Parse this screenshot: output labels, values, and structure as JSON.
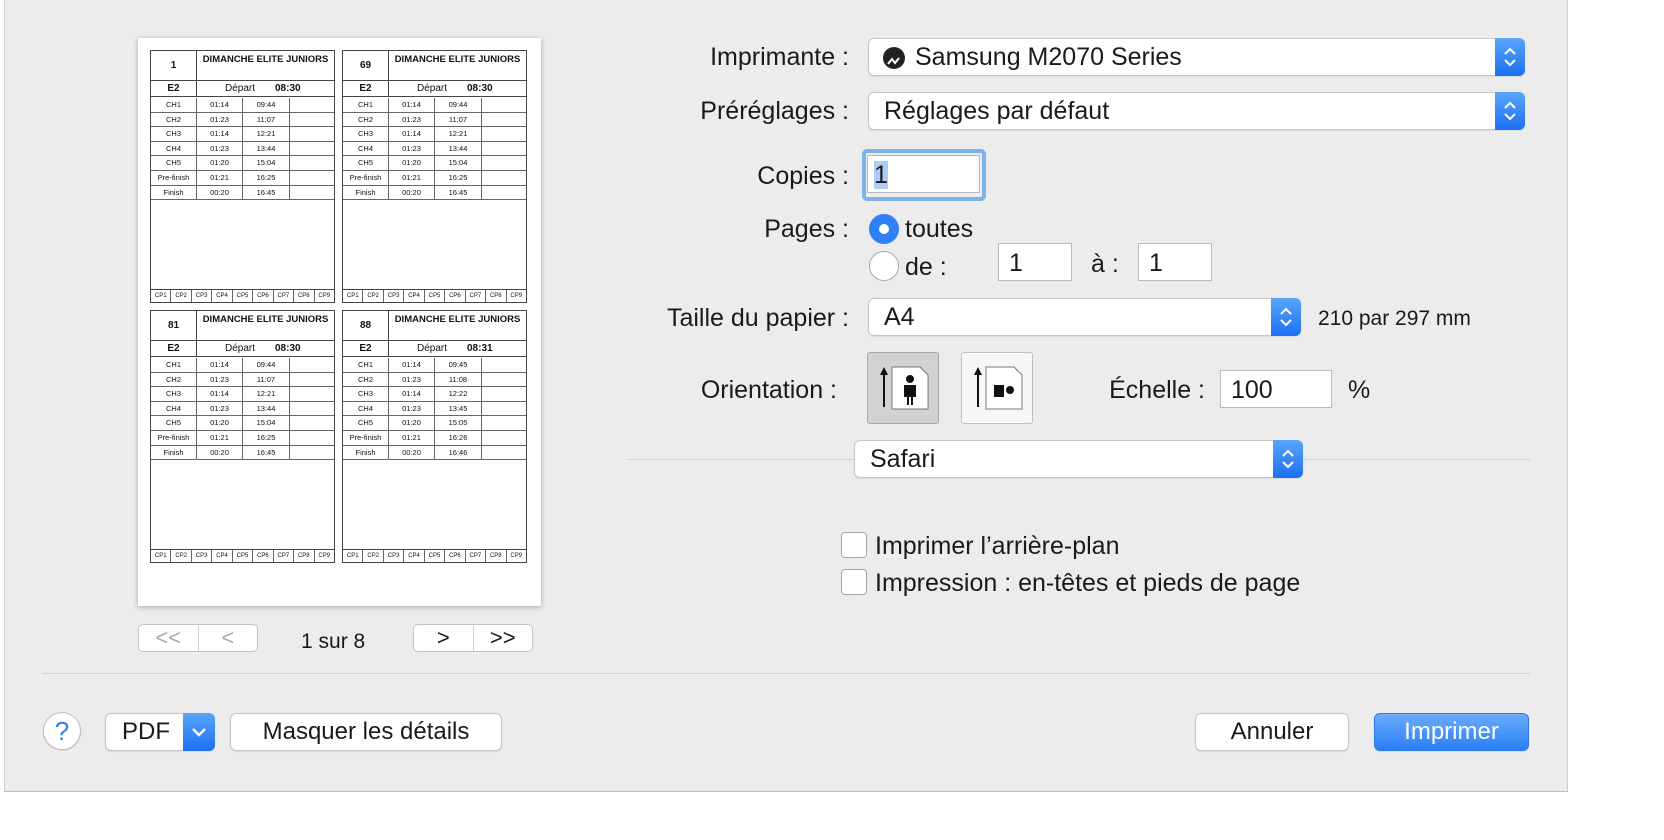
{
  "preview": {
    "page_indicator": "1 sur 8",
    "nav": {
      "first": "<<",
      "prev": "<",
      "next": ">",
      "last": ">>"
    },
    "cards": [
      {
        "number": "1",
        "category": "DIMANCHE ELITE JUNIORS",
        "group": "E2",
        "depart_label": "Départ",
        "depart_time": "08:30",
        "rows": [
          [
            "CH1",
            "01:14",
            "09:44"
          ],
          [
            "CH2",
            "01:23",
            "11:07"
          ],
          [
            "CH3",
            "01:14",
            "12:21"
          ],
          [
            "CH4",
            "01:23",
            "13:44"
          ],
          [
            "CH5",
            "01:20",
            "15:04"
          ],
          [
            "Pre-finish",
            "01:21",
            "16:25"
          ],
          [
            "Finish",
            "00:20",
            "16:45"
          ]
        ]
      },
      {
        "number": "69",
        "category": "DIMANCHE ELITE JUNIORS",
        "group": "E2",
        "depart_label": "Départ",
        "depart_time": "08:30",
        "rows": [
          [
            "CH1",
            "01:14",
            "09:44"
          ],
          [
            "CH2",
            "01:23",
            "11:07"
          ],
          [
            "CH3",
            "01:14",
            "12:21"
          ],
          [
            "CH4",
            "01:23",
            "13:44"
          ],
          [
            "CH5",
            "01:20",
            "15:04"
          ],
          [
            "Pre-finish",
            "01:21",
            "16:25"
          ],
          [
            "Finish",
            "00:20",
            "16:45"
          ]
        ]
      },
      {
        "number": "81",
        "category": "DIMANCHE ELITE JUNIORS",
        "group": "E2",
        "depart_label": "Départ",
        "depart_time": "08:30",
        "rows": [
          [
            "CH1",
            "01:14",
            "09:44"
          ],
          [
            "CH2",
            "01:23",
            "11:07"
          ],
          [
            "CH3",
            "01:14",
            "12:21"
          ],
          [
            "CH4",
            "01:23",
            "13:44"
          ],
          [
            "CH5",
            "01:20",
            "15:04"
          ],
          [
            "Pre-finish",
            "01:21",
            "16:25"
          ],
          [
            "Finish",
            "00:20",
            "16:45"
          ]
        ]
      },
      {
        "number": "88",
        "category": "DIMANCHE ELITE JUNIORS",
        "group": "E2",
        "depart_label": "Départ",
        "depart_time": "08:31",
        "rows": [
          [
            "CH1",
            "01:14",
            "09:45"
          ],
          [
            "CH2",
            "01:23",
            "11:08"
          ],
          [
            "CH3",
            "01:14",
            "12:22"
          ],
          [
            "CH4",
            "01:23",
            "13:45"
          ],
          [
            "CH5",
            "01:20",
            "15:05"
          ],
          [
            "Pre-finish",
            "01:21",
            "16:26"
          ],
          [
            "Finish",
            "00:20",
            "16:46"
          ]
        ]
      }
    ],
    "footer_cells": [
      "CP1",
      "CP2",
      "CP3",
      "CP4",
      "CP5",
      "CP6",
      "CP7",
      "CP8",
      "CP9"
    ]
  },
  "printer": {
    "label": "Imprimante :",
    "value": "Samsung M2070 Series",
    "icon": "printer-status-icon"
  },
  "presets": {
    "label": "Préréglages :",
    "value": "Réglages par défaut"
  },
  "copies": {
    "label": "Copies :",
    "value": "1"
  },
  "pages": {
    "label": "Pages :",
    "all_label": "toutes",
    "range_label": "de :",
    "from": "1",
    "to_label": "à :",
    "to": "1",
    "selected": "all"
  },
  "paper": {
    "label": "Taille du papier :",
    "value": "A4",
    "dimensions": "210 par 297 mm"
  },
  "orientation": {
    "label": "Orientation :",
    "selected": "portrait"
  },
  "scale": {
    "label": "Échelle :",
    "value": "100",
    "unit": "%"
  },
  "app_section": {
    "value": "Safari"
  },
  "options": {
    "background": {
      "label": "Imprimer l’arrière-plan",
      "checked": false
    },
    "headers": {
      "label": "Impression : en-têtes et pieds de page",
      "checked": false
    }
  },
  "footer": {
    "help": "?",
    "pdf": "PDF",
    "hide_details": "Masquer les détails",
    "cancel": "Annuler",
    "print": "Imprimer"
  },
  "colors": {
    "accent": "#2f7ff5",
    "dialog_bg": "#ececec"
  }
}
